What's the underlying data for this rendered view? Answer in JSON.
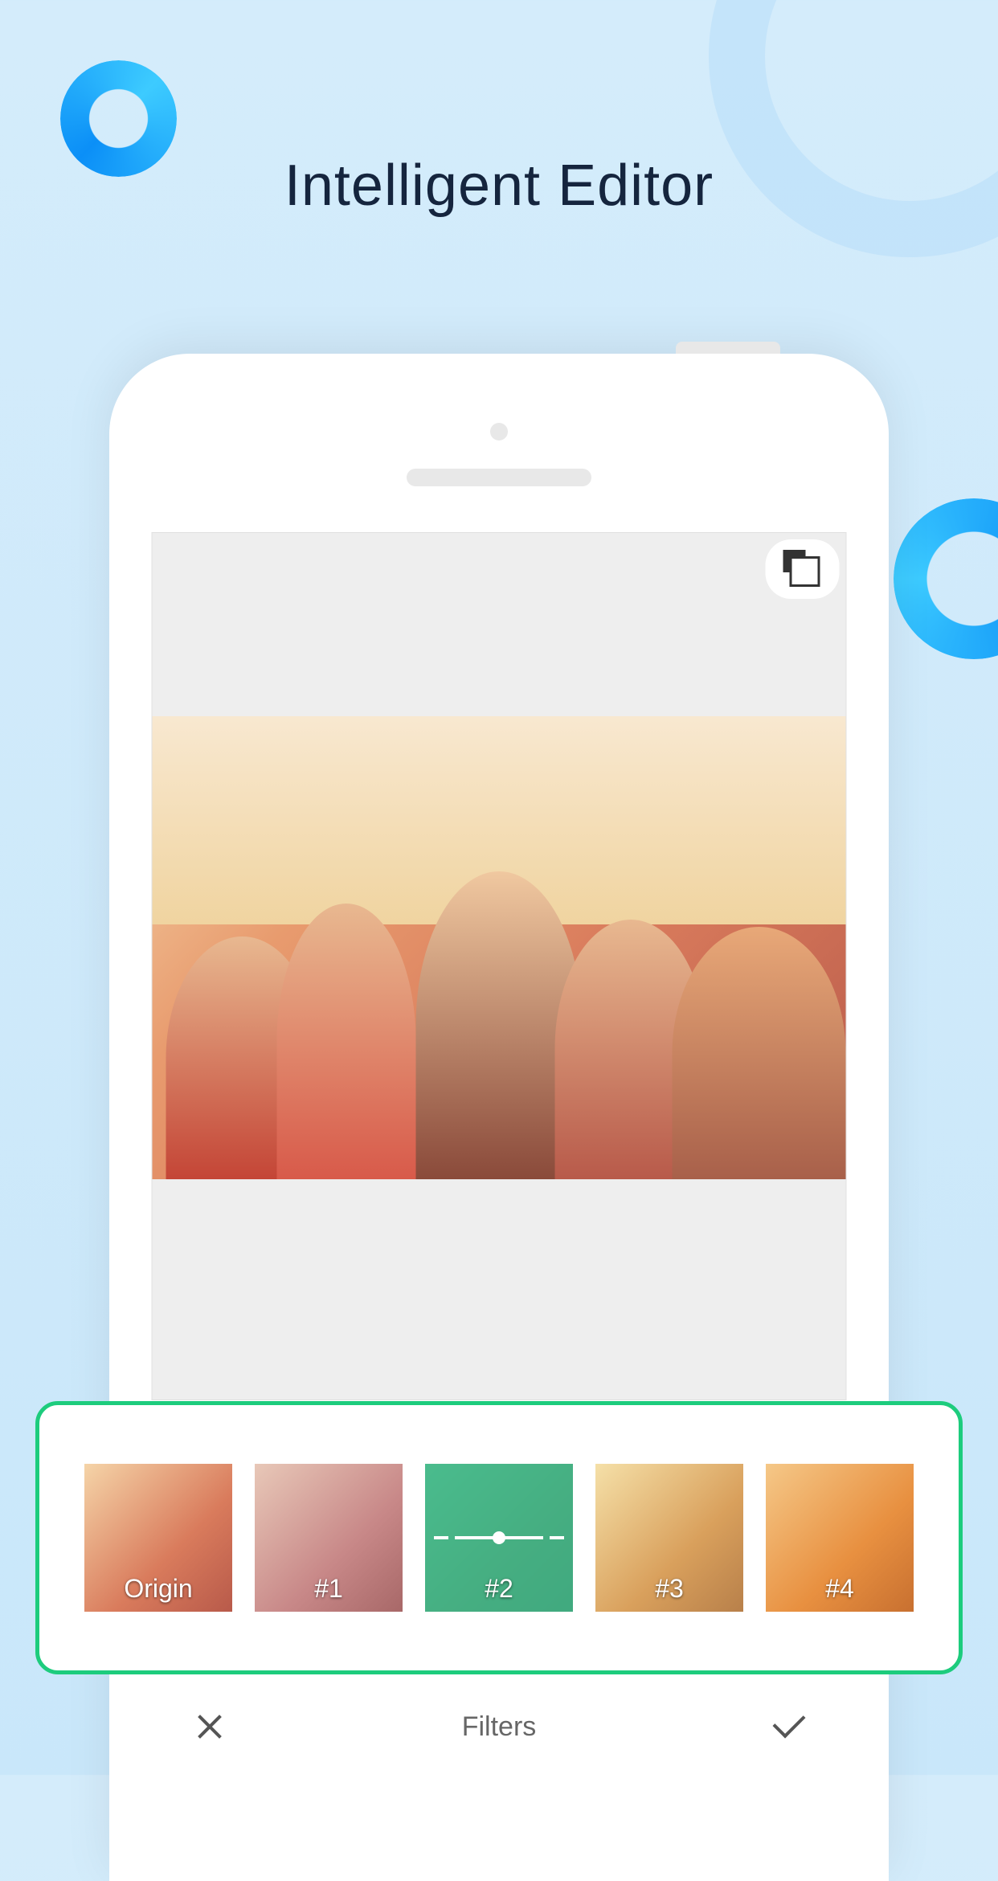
{
  "header": {
    "title": "Intelligent   Editor"
  },
  "editor": {
    "compare_button": "compare"
  },
  "filters": {
    "items": [
      {
        "label": "Origin",
        "selected": false
      },
      {
        "label": "#1",
        "selected": false
      },
      {
        "label": "#2",
        "selected": true
      },
      {
        "label": "#3",
        "selected": false
      },
      {
        "label": "#4",
        "selected": false
      }
    ]
  },
  "bottom_bar": {
    "title": "Filters",
    "cancel": "close",
    "confirm": "check"
  },
  "colors": {
    "accent_green": "#1dcc7d",
    "background": "#d4ecfb",
    "title_text": "#15253e"
  }
}
